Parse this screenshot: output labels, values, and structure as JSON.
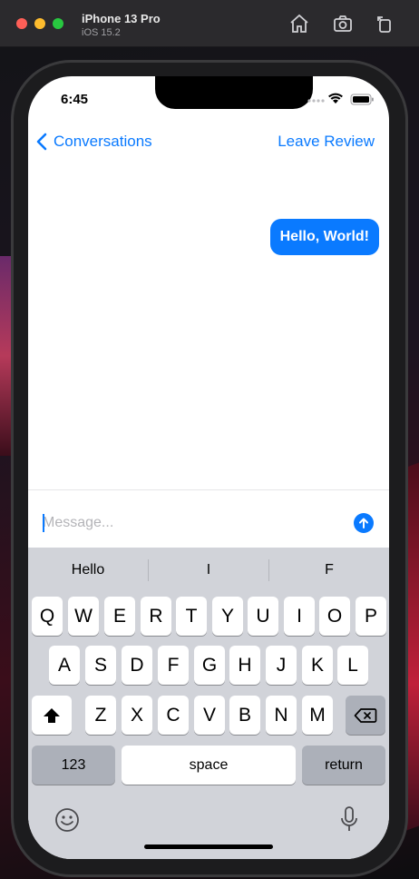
{
  "simulator": {
    "device_name": "iPhone 13 Pro",
    "os_version": "iOS 15.2",
    "icons": [
      "home-icon",
      "screenshot-icon",
      "rotate-icon"
    ]
  },
  "status_bar": {
    "time": "6:45"
  },
  "nav": {
    "back_label": "Conversations",
    "right_label": "Leave Review"
  },
  "messages": [
    {
      "text": "Hello, World!",
      "from": "me"
    }
  ],
  "composer": {
    "placeholder": "Message...",
    "value": ""
  },
  "keyboard": {
    "suggestions": [
      "Hello",
      "I",
      "F"
    ],
    "row1": [
      "Q",
      "W",
      "E",
      "R",
      "T",
      "Y",
      "U",
      "I",
      "O",
      "P"
    ],
    "row2": [
      "A",
      "S",
      "D",
      "F",
      "G",
      "H",
      "J",
      "K",
      "L"
    ],
    "row3": [
      "Z",
      "X",
      "C",
      "V",
      "B",
      "N",
      "M"
    ],
    "numbers_label": "123",
    "space_label": "space",
    "return_label": "return"
  },
  "colors": {
    "accent": "#0a7aff",
    "keyboard_bg": "#d1d3d9",
    "dark_key": "#acb0b9"
  }
}
